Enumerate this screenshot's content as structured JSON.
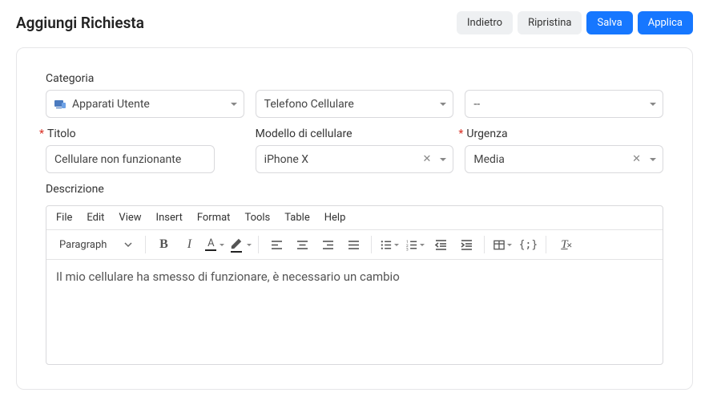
{
  "header": {
    "title": "Aggiungi Richiesta",
    "buttons": {
      "back": "Indietro",
      "reset": "Ripristina",
      "save": "Salva",
      "apply": "Applica"
    }
  },
  "form": {
    "category": {
      "label": "Categoria",
      "level1": "Apparati Utente",
      "level2": "Telefono Cellulare",
      "level3": "--"
    },
    "titleField": {
      "label": "Titolo",
      "value": "Cellulare non funzionante",
      "required": true
    },
    "model": {
      "label": "Modello di cellulare",
      "value": "iPhone X",
      "required": false
    },
    "urgency": {
      "label": "Urgenza",
      "value": "Media",
      "required": true
    },
    "description": {
      "label": "Descrizione",
      "body": "Il mio cellulare ha smesso di funzionare, è necessario un cambio"
    }
  },
  "editor": {
    "menu": {
      "file": "File",
      "edit": "Edit",
      "view": "View",
      "insert": "Insert",
      "format": "Format",
      "tools": "Tools",
      "table": "Table",
      "help": "Help"
    },
    "blockFormat": "Paragraph"
  }
}
